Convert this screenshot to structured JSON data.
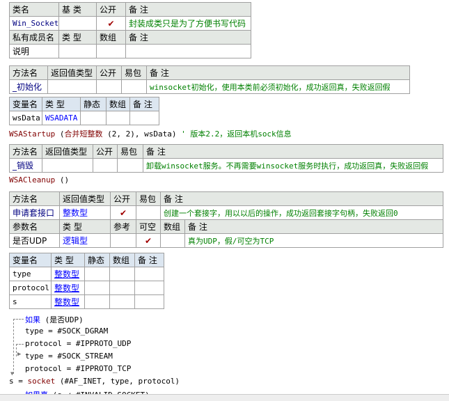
{
  "class_table": {
    "headers": [
      "类名",
      "基 类",
      "公开",
      "备 注"
    ],
    "name": "Win_Socket",
    "base": "",
    "public": true,
    "comment": "封装成类只是为了方便书写代码",
    "member_headers": [
      "私有成员名",
      "类 型",
      "数组",
      "备 注"
    ],
    "member_row": [
      "说明",
      "",
      "",
      ""
    ]
  },
  "method_init": {
    "headers": [
      "方法名",
      "返回值类型",
      "公开",
      "易包",
      "备 注"
    ],
    "name": "_初始化",
    "comment": "winsocket初始化，使用本类前必须初始化，成功返回真，失败返回假",
    "var_headers": [
      "变量名",
      "类 型",
      "静态",
      "数组",
      "备 注"
    ],
    "vars": [
      {
        "name": "wsData",
        "type": "WSADATA"
      }
    ],
    "code": {
      "fn": "WSAStartup",
      "open": " (",
      "inner": "合并短整数",
      "args": " (2, 2), wsData) ",
      "comment": "' 版本2.2，返回本机sock信息"
    }
  },
  "method_destroy": {
    "headers": [
      "方法名",
      "返回值类型",
      "公开",
      "易包",
      "备 注"
    ],
    "name": "_销毁",
    "comment": "卸载winsocket服务。不再需要winsocket服务时执行，成功返回真，失败返回假",
    "code": {
      "fn": "WSACleanup",
      "args": " ()"
    }
  },
  "method_socket": {
    "headers": [
      "方法名",
      "返回值类型",
      "公开",
      "易包",
      "备 注"
    ],
    "name": "申请套接口",
    "return_type": "整数型",
    "public": true,
    "comment": "创建一个套接字，用以以后的操作，成功返回套接字句柄，失败返回0",
    "param_headers": [
      "参数名",
      "类 型",
      "参考",
      "可空",
      "数组",
      "备 注"
    ],
    "param": {
      "name": "是否UDP",
      "type": "逻辑型",
      "nullable": true,
      "comment": "真为UDP，假/可空为TCP"
    },
    "var_headers": [
      "变量名",
      "类 型",
      "静态",
      "数组",
      "备 注"
    ],
    "vars": [
      {
        "name": "type",
        "type": "整数型"
      },
      {
        "name": "protocol",
        "type": "整数型"
      },
      {
        "name": "s",
        "type": "整数型"
      }
    ],
    "code": {
      "if_kw": "如果",
      "if_cond": " (是否UDP)",
      "l1": "type = #SOCK_DGRAM",
      "l2": "protocol = #IPPROTO_UDP",
      "l3": "type = #SOCK_STREAM",
      "l4": "protocol = #IPPROTO_TCP",
      "l5a": "s = ",
      "l5fn": "socket",
      "l5b": " (#AF_INET, type, protocol)",
      "l6kw": "如果真",
      "l6": " (s ≠ #INVALID_SOCKET)"
    }
  },
  "colors": {
    "keyword": "#0000ff",
    "function": "#800000",
    "comment": "#008000",
    "check": "#a00000"
  }
}
